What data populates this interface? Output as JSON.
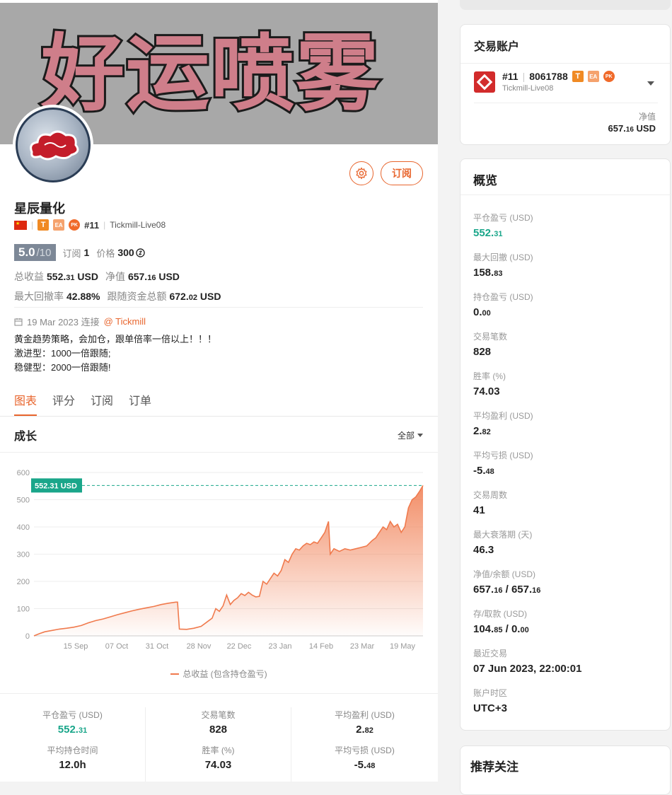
{
  "banner": {
    "text": "好运喷雾"
  },
  "profile": {
    "name": "星辰量化",
    "rank": "#11",
    "server": "Tickmill-Live08",
    "tag_t": "T",
    "tag_ea": "EA",
    "tag_pk": "PK",
    "subscribe_label": "订阅",
    "score": "5.0",
    "score_max": "/10",
    "subs_label": "订阅",
    "subs_value": "1",
    "price_label": "价格",
    "price_value": "300",
    "total_label": "总收益",
    "total_int": "552.",
    "total_dec": "31",
    "total_unit": "USD",
    "equity_label": "净值",
    "equity_int": "657.",
    "equity_dec": "16",
    "equity_unit": "USD",
    "maxdd_label": "最大回撤率",
    "maxdd_value": "42.88%",
    "follow_label": "跟随资金总额",
    "follow_int": "672.",
    "follow_dec": "02",
    "follow_unit": "USD",
    "connect_date": "19 Mar 2023 连接",
    "connect_broker": "@ Tickmill",
    "desc_lines": [
      "黄金趋势策略，会加仓，跟单倍率一倍以上！！！",
      "激进型：1000一倍跟随;",
      "稳健型：2000一倍跟随!"
    ]
  },
  "tabs": [
    "图表",
    "评分",
    "订阅",
    "订单"
  ],
  "growth": {
    "title": "成长",
    "range": "全部",
    "legend": "总收益 (包含持仓盈亏)",
    "last_label": "552.31 USD"
  },
  "chart_data": {
    "type": "area",
    "title": "",
    "ylim": [
      0,
      600
    ],
    "yticks": [
      0,
      100,
      200,
      300,
      400,
      500,
      600
    ],
    "xticks": [
      "15 Sep",
      "07 Oct",
      "31 Oct",
      "28 Nov",
      "22 Dec",
      "23 Jan",
      "14 Feb",
      "23 Mar",
      "19 May"
    ],
    "series": [
      {
        "name": "总收益 (包含持仓盈亏)",
        "color": "#f07a4d",
        "points": [
          [
            0,
            0
          ],
          [
            3,
            8
          ],
          [
            6,
            15
          ],
          [
            10,
            20
          ],
          [
            14,
            25
          ],
          [
            18,
            28
          ],
          [
            22,
            32
          ],
          [
            26,
            38
          ],
          [
            30,
            48
          ],
          [
            34,
            56
          ],
          [
            38,
            62
          ],
          [
            42,
            70
          ],
          [
            46,
            78
          ],
          [
            50,
            85
          ],
          [
            54,
            92
          ],
          [
            58,
            98
          ],
          [
            62,
            103
          ],
          [
            66,
            108
          ],
          [
            70,
            115
          ],
          [
            74,
            120
          ],
          [
            78,
            124
          ],
          [
            79,
            124
          ],
          [
            80,
            25
          ],
          [
            84,
            24
          ],
          [
            88,
            28
          ],
          [
            92,
            35
          ],
          [
            96,
            55
          ],
          [
            98,
            65
          ],
          [
            100,
            100
          ],
          [
            102,
            90
          ],
          [
            104,
            110
          ],
          [
            106,
            150
          ],
          [
            108,
            115
          ],
          [
            110,
            130
          ],
          [
            112,
            140
          ],
          [
            114,
            155
          ],
          [
            116,
            148
          ],
          [
            118,
            160
          ],
          [
            120,
            150
          ],
          [
            122,
            143
          ],
          [
            124,
            145
          ],
          [
            126,
            200
          ],
          [
            128,
            190
          ],
          [
            130,
            210
          ],
          [
            132,
            230
          ],
          [
            134,
            220
          ],
          [
            136,
            240
          ],
          [
            138,
            280
          ],
          [
            140,
            270
          ],
          [
            142,
            300
          ],
          [
            144,
            320
          ],
          [
            146,
            315
          ],
          [
            148,
            330
          ],
          [
            150,
            340
          ],
          [
            152,
            335
          ],
          [
            154,
            345
          ],
          [
            156,
            340
          ],
          [
            158,
            360
          ],
          [
            160,
            380
          ],
          [
            162,
            420
          ],
          [
            163,
            300
          ],
          [
            165,
            320
          ],
          [
            168,
            310
          ],
          [
            171,
            320
          ],
          [
            174,
            315
          ],
          [
            177,
            320
          ],
          [
            180,
            325
          ],
          [
            183,
            330
          ],
          [
            186,
            350
          ],
          [
            188,
            360
          ],
          [
            190,
            380
          ],
          [
            192,
            400
          ],
          [
            194,
            390
          ],
          [
            196,
            420
          ],
          [
            198,
            400
          ],
          [
            200,
            410
          ],
          [
            202,
            380
          ],
          [
            204,
            400
          ],
          [
            206,
            470
          ],
          [
            208,
            500
          ],
          [
            210,
            510
          ],
          [
            212,
            530
          ],
          [
            214,
            552.31
          ]
        ]
      }
    ],
    "last_value": 552.31
  },
  "stats": [
    [
      {
        "label": "平仓盈亏 (USD)",
        "int": "552.",
        "dec": "31",
        "green": true
      },
      {
        "label": "平均持仓时间",
        "int": "12.0h",
        "dec": ""
      }
    ],
    [
      {
        "label": "交易笔数",
        "int": "828",
        "dec": ""
      },
      {
        "label": "胜率 (%)",
        "int": "74.03",
        "dec": ""
      }
    ],
    [
      {
        "label": "平均盈利 (USD)",
        "int": "2.",
        "dec": "82"
      },
      {
        "label": "平均亏损 (USD)",
        "int": "-5.",
        "dec": "48"
      }
    ]
  ],
  "account": {
    "title": "交易账户",
    "rank": "#11",
    "number": "8061788",
    "tag_t": "T",
    "tag_ea": "EA",
    "tag_pk": "PK",
    "server": "Tickmill-Live08",
    "equity_label": "净值",
    "equity_int": "657.",
    "equity_dec": "16",
    "equity_unit": "USD"
  },
  "overview": {
    "title": "概览",
    "items": [
      {
        "label": "平仓盈亏 (USD)",
        "parts": [
          [
            "552.",
            "31"
          ]
        ],
        "green": true
      },
      {
        "label": "最大回撤 (USD)",
        "parts": [
          [
            "158.",
            "83"
          ]
        ]
      },
      {
        "label": "持仓盈亏 (USD)",
        "parts": [
          [
            "0.",
            "00"
          ]
        ]
      },
      {
        "label": "交易笔数",
        "parts": [
          [
            "828",
            ""
          ]
        ]
      },
      {
        "label": "胜率 (%)",
        "parts": [
          [
            "74.03",
            ""
          ]
        ]
      },
      {
        "label": "平均盈利 (USD)",
        "parts": [
          [
            "2.",
            "82"
          ]
        ]
      },
      {
        "label": "平均亏损 (USD)",
        "parts": [
          [
            "-5.",
            "48"
          ]
        ]
      },
      {
        "label": "交易周数",
        "parts": [
          [
            "41",
            ""
          ]
        ]
      },
      {
        "label": "最大衰落期 (天)",
        "parts": [
          [
            "46.3",
            ""
          ]
        ]
      },
      {
        "label": "净值/余额 (USD)",
        "parts": [
          [
            "657.",
            "16"
          ],
          [
            "657.",
            "16"
          ]
        ]
      },
      {
        "label": "存/取款 (USD)",
        "parts": [
          [
            "104.",
            "85"
          ],
          [
            "0.",
            "00"
          ]
        ]
      },
      {
        "label": "最近交易",
        "parts": [
          [
            "07 Jun 2023, 22:00:01",
            ""
          ]
        ]
      },
      {
        "label": "账户时区",
        "parts": [
          [
            "UTC+3",
            ""
          ]
        ]
      }
    ]
  },
  "recommend": {
    "title": "推荐关注"
  }
}
